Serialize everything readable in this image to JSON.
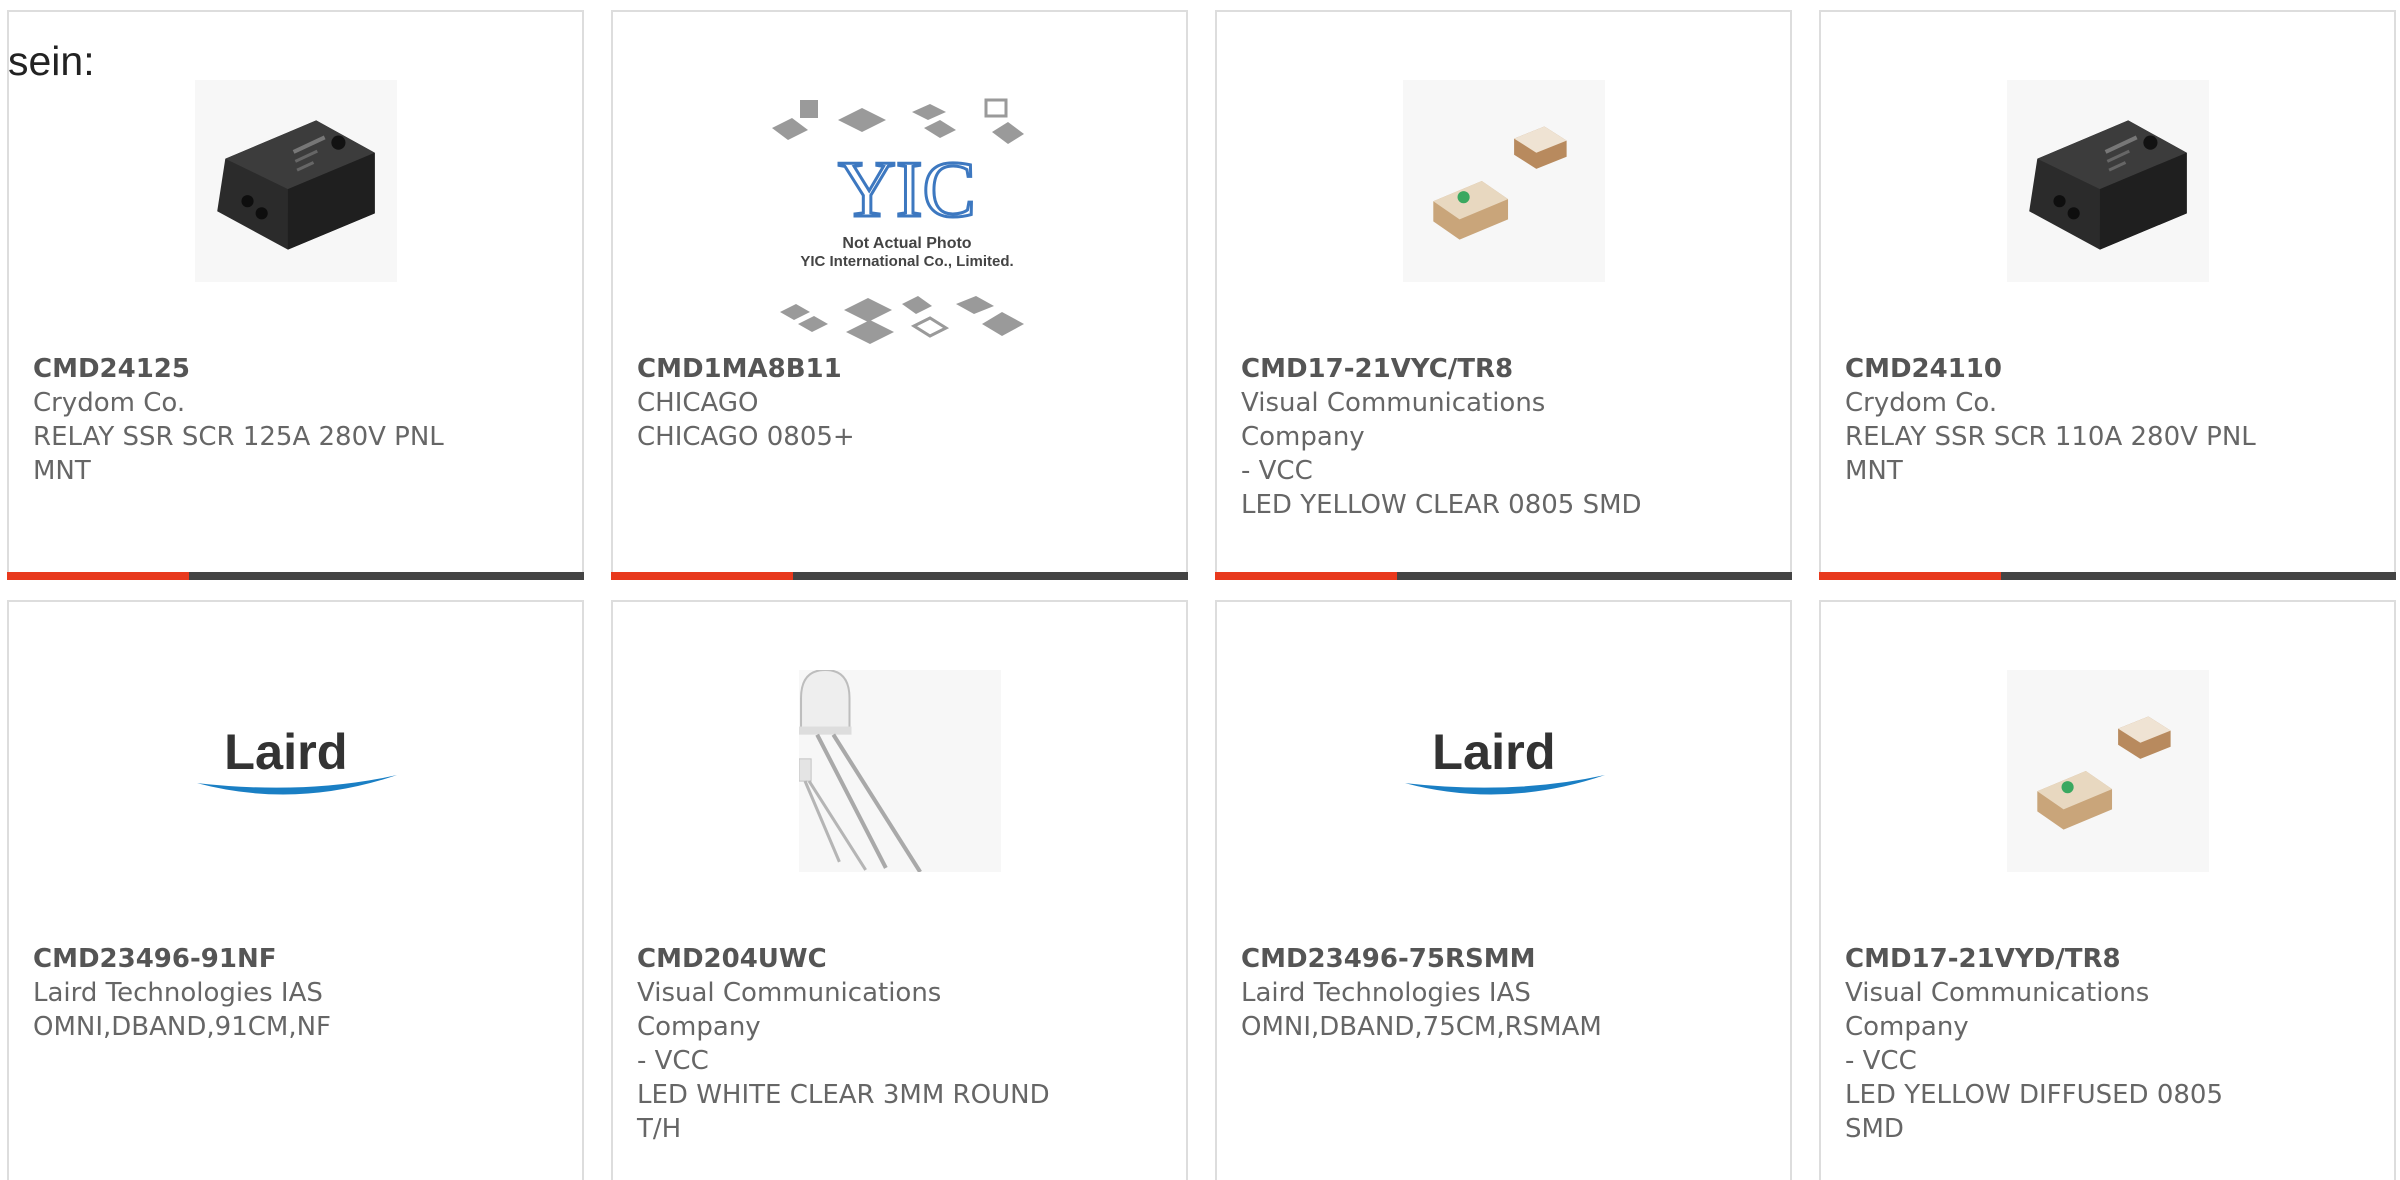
{
  "heading": "sein:",
  "colors": {
    "accent": "#e8391d",
    "bar": "#444444",
    "border": "#dddddd",
    "text": "#666666"
  },
  "products": [
    {
      "part": "CMD24125",
      "manufacturer": "Crydom Co.",
      "description": "RELAY SSR SCR 125A 280V PNL\nMNT",
      "image": "ssr-relay-module"
    },
    {
      "part": "CMD1MA8B11",
      "manufacturer": "CHICAGO",
      "description": "CHICAGO 0805+",
      "image": "yic-placeholder-chips",
      "image_text": {
        "logo": "YIC",
        "line1": "Not Actual Photo",
        "line2": "YIC International Co., Limited."
      }
    },
    {
      "part": "CMD17-21VYC/TR8",
      "manufacturer": "Visual Communications Company\n- VCC",
      "description": "LED YELLOW CLEAR 0805 SMD",
      "image": "smd-led-pair"
    },
    {
      "part": "CMD24110",
      "manufacturer": "Crydom Co.",
      "description": "RELAY SSR SCR 110A 280V PNL\nMNT",
      "image": "ssr-relay-module"
    },
    {
      "part": "CMD23496-91NF",
      "manufacturer": "Laird Technologies IAS",
      "description": "OMNI,DBAND,91CM,NF",
      "image": "laird-logo",
      "image_text": {
        "logo": "Laird"
      }
    },
    {
      "part": "CMD204UWC",
      "manufacturer": "Visual Communications Company\n- VCC",
      "description": "LED WHITE CLEAR 3MM ROUND\nT/H",
      "image": "through-hole-led"
    },
    {
      "part": "CMD23496-75RSMM",
      "manufacturer": "Laird Technologies IAS",
      "description": "OMNI,DBAND,75CM,RSMAM",
      "image": "laird-logo",
      "image_text": {
        "logo": "Laird"
      }
    },
    {
      "part": "CMD17-21VYD/TR8",
      "manufacturer": "Visual Communications Company\n- VCC",
      "description": "LED YELLOW DIFFUSED 0805\nSMD",
      "image": "smd-led-pair"
    }
  ]
}
